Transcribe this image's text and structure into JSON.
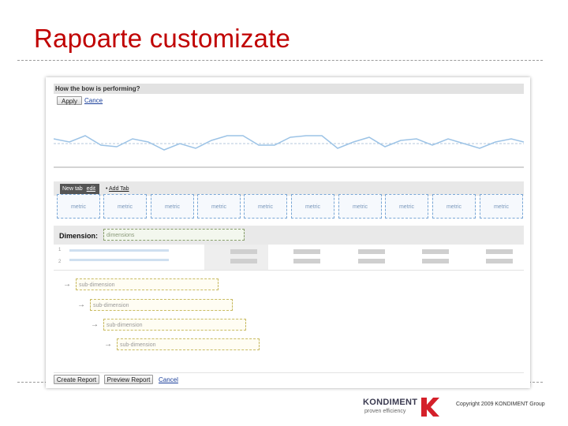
{
  "slide": {
    "title": "Rapoarte customizate"
  },
  "report": {
    "question": "How the bow is performing?",
    "apply_label": "Apply",
    "cancel_top_label": "Cance",
    "tab_active": "New tab",
    "tab_edit": "edit",
    "add_tab": "Add Tab",
    "metrics": [
      "metric",
      "metric",
      "metric",
      "metric",
      "metric",
      "metric",
      "metric",
      "metric",
      "metric",
      "metric"
    ],
    "dimension_label": "Dimension:",
    "dimension_placeholder": "dimensions",
    "row_numbers": [
      "1",
      "2"
    ],
    "sub_dimensions": [
      "sub-dimension",
      "sub-dimension",
      "sub-dimension",
      "sub-dimension"
    ],
    "create_label": "Create Report",
    "preview_label": "Preview Report",
    "cancel_label": "Cancel"
  },
  "footer": {
    "logo_text": "KONDIMENT",
    "logo_tagline": "proven efficiency",
    "copyright": "Copyright 2009 KONDIMENT Group"
  },
  "colors": {
    "title": "#c00000",
    "logo_k": "#d4202a",
    "metric_border": "#7aa7d6",
    "sparkline": "#9cc3e6"
  },
  "icons": {
    "row_arrow": "arrow-right-icon",
    "logo": "kondiment-k-icon"
  }
}
